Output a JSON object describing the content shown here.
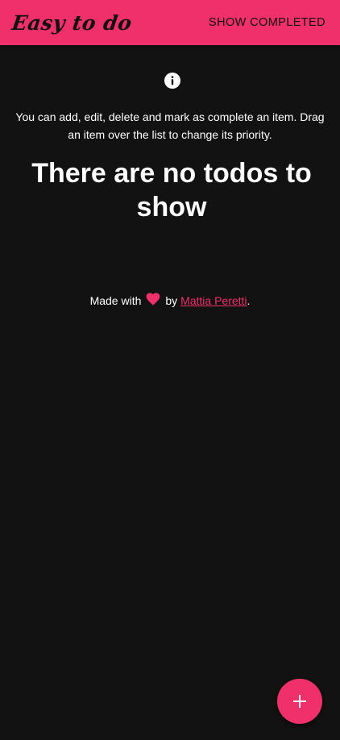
{
  "appbar": {
    "title": "Easy to do",
    "show_completed_label": "SHOW COMPLETED"
  },
  "info": {
    "icon": "info-icon",
    "text": "You can add, edit, delete and mark as complete an item. Drag an item over the list to change its priority."
  },
  "empty_state": {
    "title": "There are no todos to show"
  },
  "footer": {
    "made_with": "Made with",
    "heart_icon": "heart-icon",
    "by": "by",
    "author": "Mattia Peretti",
    "end": "."
  },
  "fab": {
    "icon": "plus-icon"
  },
  "colors": {
    "accent": "#f0306a",
    "background": "#121212",
    "text": "#ffffff",
    "appbar_text": "#111111"
  }
}
